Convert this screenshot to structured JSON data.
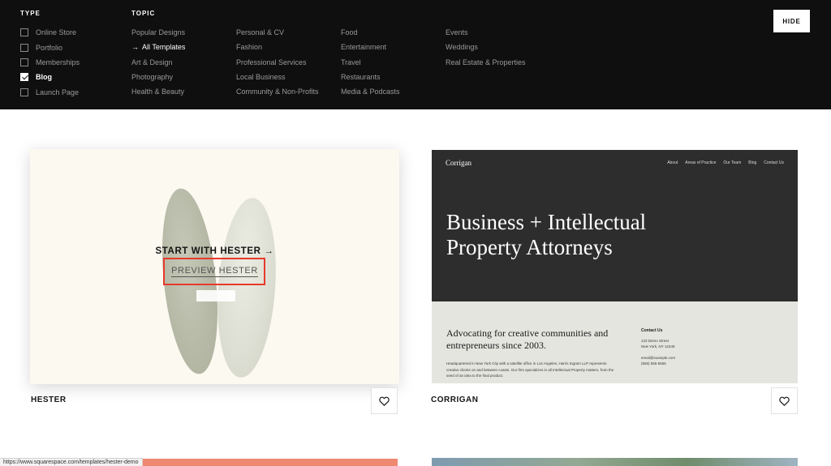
{
  "filters": {
    "type_title": "TYPE",
    "topic_title": "TOPIC",
    "types": [
      {
        "label": "Online Store",
        "checked": false
      },
      {
        "label": "Portfolio",
        "checked": false
      },
      {
        "label": "Memberships",
        "checked": false
      },
      {
        "label": "Blog",
        "checked": true
      },
      {
        "label": "Launch Page",
        "checked": false
      }
    ],
    "topics": {
      "col1": [
        "Popular Designs",
        "All Templates",
        "Art & Design",
        "Photography",
        "Health & Beauty"
      ],
      "col2": [
        "Personal & CV",
        "Fashion",
        "Professional Services",
        "Local Business",
        "Community & Non-Profits"
      ],
      "col3": [
        "Food",
        "Entertainment",
        "Travel",
        "Restaurants",
        "Media & Podcasts"
      ],
      "col4": [
        "Events",
        "Weddings",
        "Real Estate & Properties"
      ]
    },
    "active_topic": "All Templates",
    "hide_label": "HIDE"
  },
  "cards": {
    "hester": {
      "name": "HESTER",
      "start_label": "START WITH HESTER →",
      "preview_label": "PREVIEW HESTER"
    },
    "corrigan": {
      "name": "CORRIGAN",
      "brand": "Corrigan",
      "nav": [
        "About",
        "Areas of Practice",
        "Our Team",
        "Blog",
        "Contact Us"
      ],
      "hero": "Business + Intellectual Property Attorneys",
      "advocate": "Advocating for creative communities and entrepreneurs since 2003.",
      "paragraph": "Headquartered in New York City with a satellite office in Los Angeles, Harris Ingram LLP represents creative clients on and between coasts. Our firm specializes in all Intellectual Property matters, from the seed of an idea to the final product.",
      "contact_title": "Contact Us",
      "contact_lines": [
        "123 Demo Street",
        "New York, NY 12345",
        "",
        "email@example.com",
        "(555) 555-5555"
      ]
    }
  },
  "icons": {
    "favorite": "heart-outline-icon",
    "arrow": "arrow-right-icon",
    "check": "checkmark-icon"
  },
  "colors": {
    "header_bg": "#0f0f0f",
    "highlight_box": "#e8392b",
    "hester_bg": "#fcf9f1",
    "corrigan_dark": "#2d2d2d",
    "corrigan_light": "#e4e5df"
  },
  "status_bar": {
    "url": "https://www.squarespace.com/templates/hester-demo"
  }
}
